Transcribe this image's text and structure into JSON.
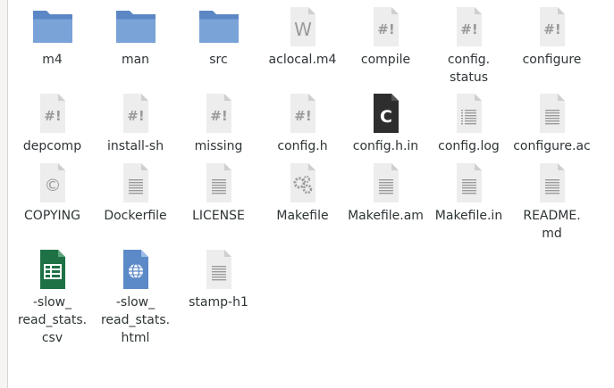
{
  "files": [
    {
      "label": "m4",
      "icon": "folder-icon"
    },
    {
      "label": "man",
      "icon": "folder-icon"
    },
    {
      "label": "src",
      "icon": "folder-icon"
    },
    {
      "label": "aclocal.m4",
      "icon": "text-w-icon"
    },
    {
      "label": "compile",
      "icon": "script-icon"
    },
    {
      "label": "config.\nstatus",
      "icon": "script-icon"
    },
    {
      "label": "configure",
      "icon": "script-icon"
    },
    {
      "label": "depcomp",
      "icon": "script-icon"
    },
    {
      "label": "install-sh",
      "icon": "script-icon"
    },
    {
      "label": "missing",
      "icon": "script-icon"
    },
    {
      "label": "config.h",
      "icon": "script-icon"
    },
    {
      "label": "config.h.in",
      "icon": "c-source-icon"
    },
    {
      "label": "config.log",
      "icon": "log-icon"
    },
    {
      "label": "configure.ac",
      "icon": "text-icon"
    },
    {
      "label": "COPYING",
      "icon": "copyright-icon"
    },
    {
      "label": "Dockerfile",
      "icon": "text-icon"
    },
    {
      "label": "LICENSE",
      "icon": "text-icon"
    },
    {
      "label": "Makefile",
      "icon": "makefile-icon"
    },
    {
      "label": "Makefile.am",
      "icon": "text-icon"
    },
    {
      "label": "Makefile.in",
      "icon": "text-icon"
    },
    {
      "label": "README.\nmd",
      "icon": "text-icon"
    },
    {
      "label": "-slow_\nread_stats.\ncsv",
      "icon": "spreadsheet-icon"
    },
    {
      "label": "-slow_\nread_stats.\nhtml",
      "icon": "html-icon"
    },
    {
      "label": "stamp-h1",
      "icon": "text-icon"
    }
  ],
  "icon_glyphs": {
    "script": "#!",
    "text_w": "W",
    "c_source": "C",
    "copyright": "©"
  },
  "colors": {
    "folder": "#5b87c4",
    "folder_light": "#7aa3d8",
    "doc": "#ededed",
    "doc_fold": "#cfcfcf",
    "glyph": "#9a9a9a",
    "dark_doc": "#2e2e2e",
    "spreadsheet": "#1e7145",
    "html": "#5c8ac8"
  }
}
